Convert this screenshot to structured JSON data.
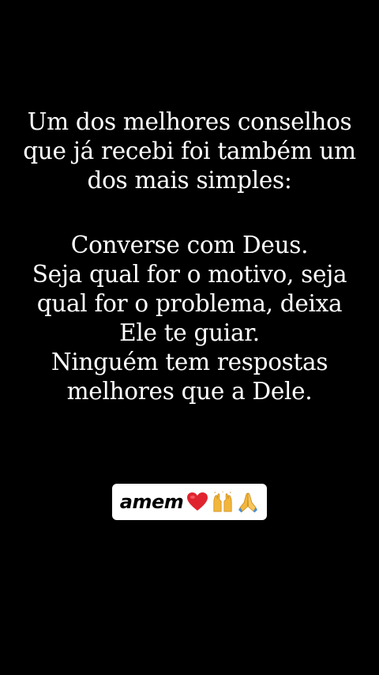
{
  "story": {
    "paragraph1": [
      "Um dos melhores conselhos",
      "que já recebi foi também um",
      "dos mais simples:"
    ],
    "paragraph2": [
      "Converse com Deus.",
      "Seja qual for o motivo, seja",
      "qual for o problema, deixa",
      "Ele te guiar.",
      "Ninguém tem respostas",
      "melhores que a Dele."
    ]
  },
  "sticker": {
    "word": "amem",
    "icons": [
      "red-heart-icon",
      "raising-hands-icon",
      "praying-hands-icon"
    ]
  },
  "colors": {
    "background": "#000000",
    "text": "#ffffff",
    "sticker_bg": "#ffffff",
    "heart": "#e0242f",
    "hands": "#f2b63c"
  }
}
